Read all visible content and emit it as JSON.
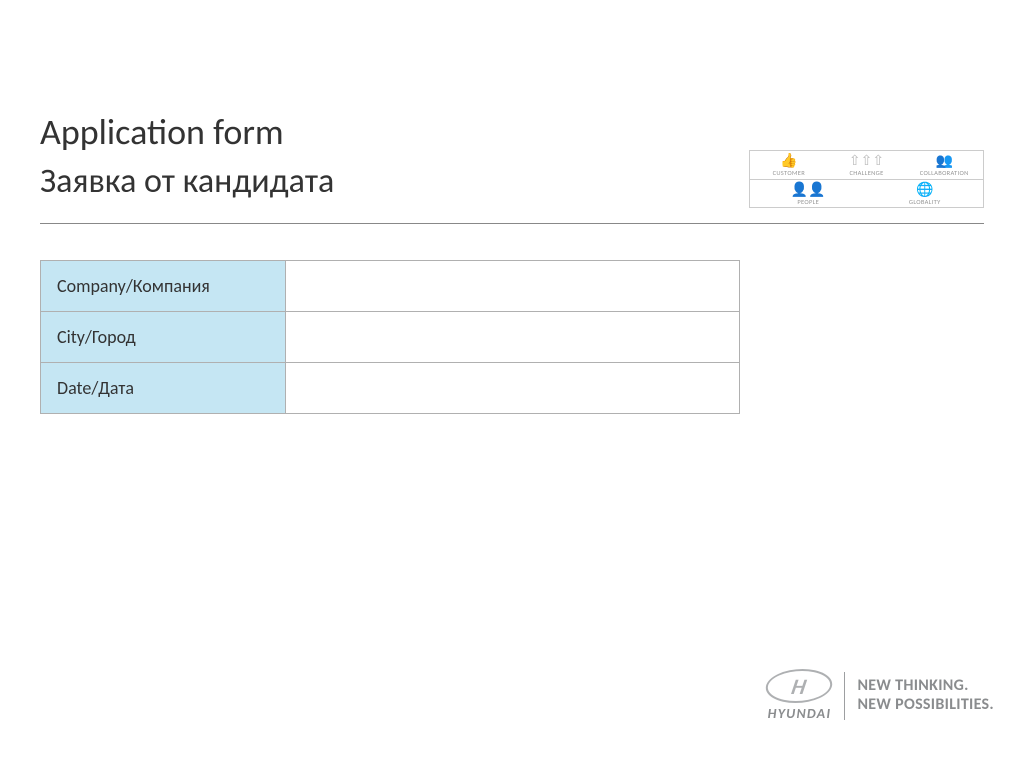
{
  "header": {
    "title_en": "Application form",
    "title_ru": "Заявка от кандидата"
  },
  "values_graphic": {
    "top": [
      {
        "icon": "👍",
        "label": "CUSTOMER"
      },
      {
        "icon": "⇧⇧⇧",
        "label": "CHALLENGE"
      },
      {
        "icon": "👥",
        "label": "COLLABORATION"
      }
    ],
    "bottom": [
      {
        "icon": "👤👤",
        "label": "PEOPLE"
      },
      {
        "icon": "🌐",
        "label": "GLOBALITY"
      }
    ]
  },
  "form": {
    "rows": [
      {
        "label": "Company/Компания",
        "value": ""
      },
      {
        "label": "City/Город",
        "value": ""
      },
      {
        "label": "Date/Дата",
        "value": ""
      }
    ]
  },
  "footer": {
    "logo_letter": "H",
    "logo_word": "HYUNDAI",
    "tagline_1": "NEW THINKING.",
    "tagline_2": "NEW POSSIBILITIES."
  }
}
